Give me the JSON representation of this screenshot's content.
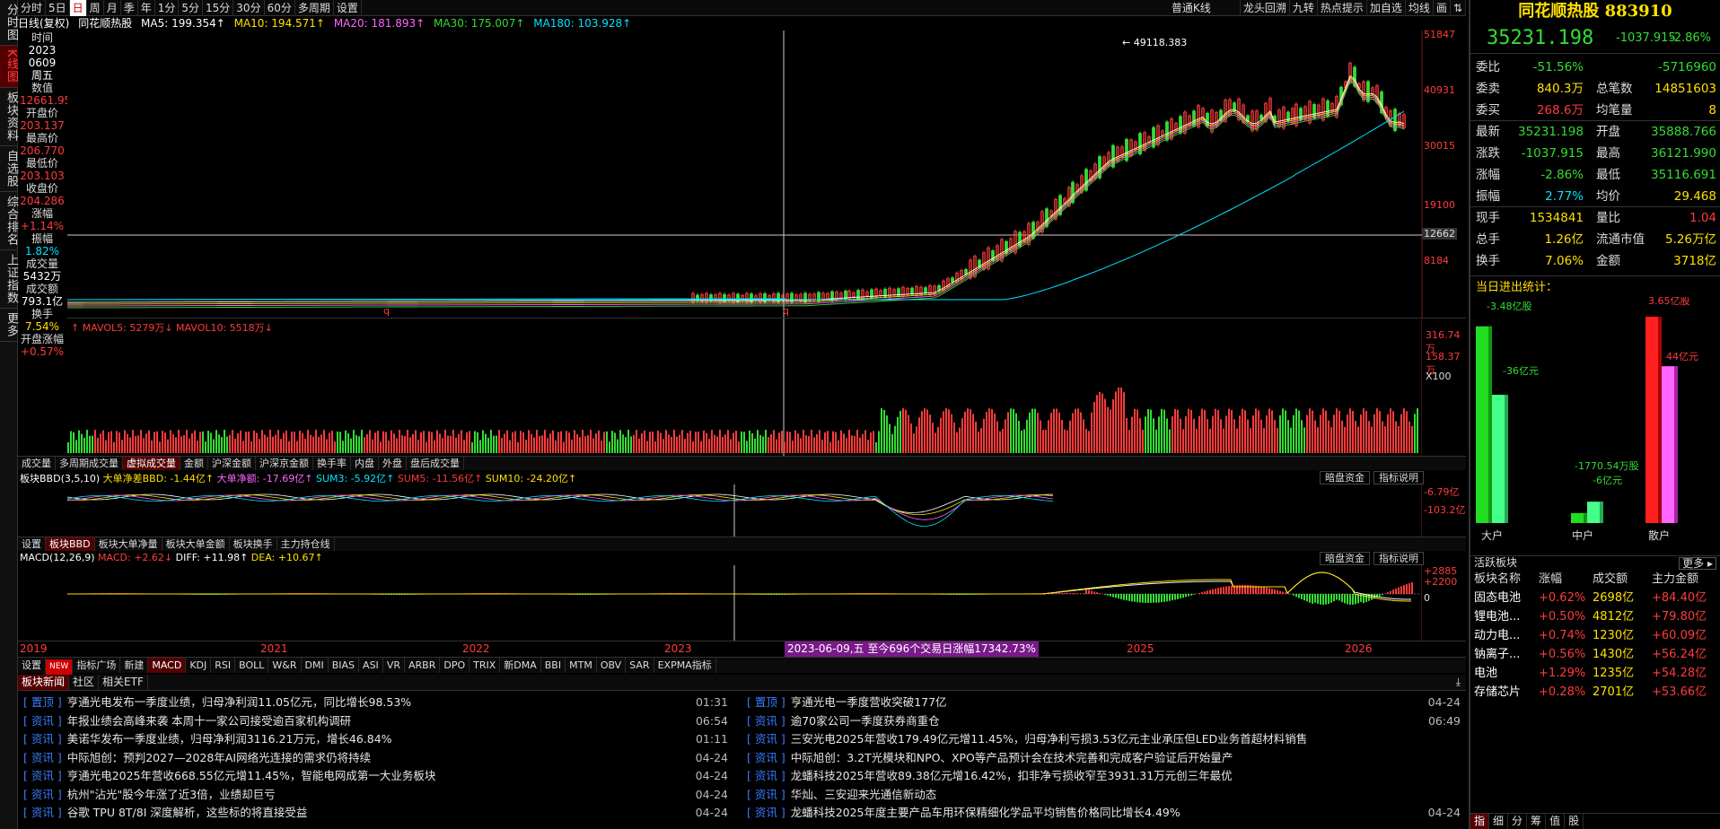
{
  "left_nav": [
    "分时图",
    "K线图",
    "板块资料",
    "自选股",
    "综合排名",
    "上证指数",
    "更多"
  ],
  "toolbar": {
    "periods": [
      "分时",
      "5日",
      "日",
      "周",
      "月",
      "季",
      "年",
      "1分",
      "5分",
      "15分",
      "30分",
      "60分",
      "多周期",
      "设置"
    ],
    "active_period": "日",
    "right_items": [
      "普通K线",
      "龙头回溯",
      "九转",
      "热点提示",
      "加自选",
      "均线",
      "画",
      "⇅"
    ]
  },
  "ma_line": {
    "label": "日线(复权)",
    "name": "同花顺热股",
    "ma5": "MA5: 199.354↑",
    "ma10": "MA10: 194.571↑",
    "ma20": "MA20: 181.893↑",
    "ma30": "MA30: 175.007↑",
    "ma180": "MA180: 103.928↑"
  },
  "info": [
    {
      "label": "时间",
      "value": "2023"
    },
    {
      "label": "",
      "value": "0609"
    },
    {
      "label": "",
      "value": "周五"
    },
    {
      "label": "数值",
      "value": "12661.956"
    },
    {
      "label": "开盘价",
      "value": "203.137"
    },
    {
      "label": "最高价",
      "value": "206.770"
    },
    {
      "label": "最低价",
      "value": "203.103"
    },
    {
      "label": "收盘价",
      "value": "204.286"
    },
    {
      "label": "涨幅",
      "value": "+1.14%"
    },
    {
      "label": "振幅",
      "value": "1.82%"
    },
    {
      "label": "成交量",
      "value": "5432万"
    },
    {
      "label": "成交额",
      "value": "793.1亿"
    },
    {
      "label": "换手",
      "value": "7.54%"
    },
    {
      "label": "开盘涨幅",
      "value": "+0.57%"
    }
  ],
  "price_axis": [
    "51847",
    "40931",
    "30015",
    "19100",
    "8184"
  ],
  "cursor_price": "12662",
  "max_label": "49118.383",
  "q_marks": [
    "q",
    "q"
  ],
  "volume": {
    "legend": "↑ MAVOL5: 5279万↓ MAVOL10: 5518万↓",
    "axis": [
      "316.74万",
      "158.37万",
      "X100"
    ]
  },
  "vol_tabs": [
    "成交量",
    "多周期成交量",
    "虚拟成交量",
    "金额",
    "沪深金额",
    "沪深京金额",
    "换手率",
    "内盘",
    "外盘",
    "盘后成交量"
  ],
  "vol_active": "虚拟成交量",
  "bbd": {
    "legend": "板块BBD(3,5,10)",
    "items": [
      "大单净差BBD: -1.44亿↑",
      "大单净额: -17.69亿↑",
      "SUM3: -5.92亿↑",
      "SUM5: -11.56亿↑",
      "SUM10: -24.20亿↑"
    ],
    "buttons": [
      "暗盘资金",
      "指标说明"
    ],
    "axis": [
      "-6.79亿",
      "-103.2亿"
    ]
  },
  "bbd_tabs": [
    "设置",
    "板块BBD",
    "板块大单净量",
    "板块大单金额",
    "板块换手",
    "主力持仓线"
  ],
  "bbd_active": "板块BBD",
  "macd": {
    "legend": "MACD(12,26,9)",
    "items": [
      "MACD: +2.62↓",
      "DIFF: +11.98↑",
      "DEA: +10.67↑"
    ],
    "buttons": [
      "暗盘资金",
      "指标说明"
    ],
    "axis": [
      "+2885",
      "+2200",
      "0"
    ]
  },
  "date_axis": [
    "2019",
    "2021",
    "2022",
    "2023",
    "2025",
    "2026"
  ],
  "date_highlight": "2023-06-09,五 至今696个交易日涨幅17342.73%",
  "ind_tabs": [
    "设置",
    "NEW",
    "指标广场",
    "新建",
    "MACD",
    "KDJ",
    "RSI",
    "BOLL",
    "W&R",
    "DMI",
    "BIAS",
    "ASI",
    "VR",
    "ARBR",
    "DPO",
    "TRIX",
    "新DMA",
    "BBI",
    "MTM",
    "OBV",
    "SAR",
    "EXPMA指标"
  ],
  "ind_active": "MACD",
  "news_tabs": [
    "板块新闻",
    "社区",
    "相关ETF"
  ],
  "news_left": [
    {
      "tag": "置顶",
      "title": "亨通光电发布一季度业绩，归母净利润11.05亿元，同比增长98.53%",
      "time": "01:31"
    },
    {
      "tag": "资讯",
      "title": "年报业绩会高峰来袭 本周十一家公司接受逾百家机构调研",
      "time": "06:54"
    },
    {
      "tag": "资讯",
      "title": "美诺华发布一季度业绩，归母净利润3116.21万元，增长46.84%",
      "time": "01:11"
    },
    {
      "tag": "资讯",
      "title": "中际旭创：预判2027—2028年AI网络光连接的需求仍将持续",
      "time": "04-24"
    },
    {
      "tag": "资讯",
      "title": "亨通光电2025年营收668.55亿元增11.45%，智能电网成第一大业务板块",
      "time": "04-24"
    },
    {
      "tag": "资讯",
      "title": "杭州\"沾光\"股今年涨了近3倍，业绩却巨亏",
      "time": "04-24"
    },
    {
      "tag": "资讯",
      "title": "谷歌 TPU 8T/8I 深度解析，这些标的将直接受益",
      "time": "04-24"
    }
  ],
  "news_right": [
    {
      "tag": "置顶",
      "title": "亨通光电一季度营收突破177亿",
      "time": "04-24"
    },
    {
      "tag": "资讯",
      "title": "逾70家公司一季度获券商重仓",
      "time": "06:49"
    },
    {
      "tag": "资讯",
      "title": "三安光电2025年营收179.49亿元增11.45%，归母净利亏损3.53亿元主业承压但LED业务首超材料销售",
      "time": ""
    },
    {
      "tag": "资讯",
      "title": "中际旭创：3.2T光模块和NPO、XPO等产品预计会在技术完善和完成客户验证后开始量产",
      "time": ""
    },
    {
      "tag": "资讯",
      "title": "龙蟠科技2025年营收89.38亿元增16.42%，扣非净亏损收窄至3931.31万元创三年最优",
      "time": ""
    },
    {
      "tag": "资讯",
      "title": "华灿、三安迎来光通信新动态",
      "time": ""
    },
    {
      "tag": "资讯",
      "title": "龙蟠科技2025年度主要产品车用环保精细化学品平均销售价格同比增长4.49%",
      "time": "04-24"
    }
  ],
  "right": {
    "title": "同花顺热股",
    "code": "883910",
    "price": "35231.198",
    "change": "-1037.915",
    "pct": "-2.86%",
    "rows": [
      {
        "l1": "委比",
        "v1": "-51.56%",
        "c1": "green",
        "l2": "",
        "v2": "-5716960",
        "c2": "green"
      },
      {
        "l1": "委卖",
        "v1": "840.3万",
        "c1": "yellow",
        "l2": "总笔数",
        "v2": "14851603",
        "c2": "yellow"
      },
      {
        "l1": "委买",
        "v1": "268.6万",
        "c1": "red",
        "l2": "均笔量",
        "v2": "8",
        "c2": "yellow"
      },
      {
        "l1": "最新",
        "v1": "35231.198",
        "c1": "green",
        "l2": "开盘",
        "v2": "35888.766",
        "c2": "green"
      },
      {
        "l1": "涨跌",
        "v1": "-1037.915",
        "c1": "green",
        "l2": "最高",
        "v2": "36121.990",
        "c2": "green"
      },
      {
        "l1": "涨幅",
        "v1": "-2.86%",
        "c1": "green",
        "l2": "最低",
        "v2": "35116.691",
        "c2": "green"
      },
      {
        "l1": "振幅",
        "v1": "2.77%",
        "c1": "cyan",
        "l2": "均价",
        "v2": "29.468",
        "c2": "yellow"
      },
      {
        "l1": "现手",
        "v1": "1534841",
        "c1": "yellow",
        "l2": "量比",
        "v2": "1.04",
        "c2": "red"
      },
      {
        "l1": "总手",
        "v1": "1.26亿",
        "c1": "yellow",
        "l2": "流通市值",
        "v2": "5.26万亿",
        "c2": "yellow"
      },
      {
        "l1": "换手",
        "v1": "7.06%",
        "c1": "yellow",
        "l2": "金额",
        "v2": "3718亿",
        "c2": "yellow"
      }
    ],
    "flow_title": "当日进出统计：",
    "flow_labels": [
      "-3.48亿股",
      "-36亿元",
      "-1770.54万股",
      "-6亿元",
      "3.65亿股",
      "44亿元"
    ],
    "flow_cats": [
      "大户",
      "中户",
      "散户"
    ],
    "hot_title": "活跃板块",
    "hot_more": "更多 ▸",
    "hot_headers": [
      "板块名称",
      "涨幅",
      "成交额",
      "主力金额"
    ],
    "hot_rows": [
      [
        "固态电池",
        "+0.62%",
        "2698亿",
        "+84.40亿"
      ],
      [
        "锂电池...",
        "+0.50%",
        "4812亿",
        "+79.80亿"
      ],
      [
        "动力电...",
        "+0.74%",
        "1230亿",
        "+60.09亿"
      ],
      [
        "钠离子...",
        "+0.56%",
        "1430亿",
        "+56.24亿"
      ],
      [
        "电池",
        "+1.29%",
        "1235亿",
        "+54.28亿"
      ],
      [
        "存储芯片",
        "+0.28%",
        "2701亿",
        "+53.66亿"
      ]
    ],
    "bottom_tabs": [
      "指",
      "细",
      "分",
      "筹",
      "值",
      "股"
    ]
  },
  "colors": {
    "up": "#ff3b3b",
    "down": "#33dd33",
    "accent": "#ffe100"
  }
}
